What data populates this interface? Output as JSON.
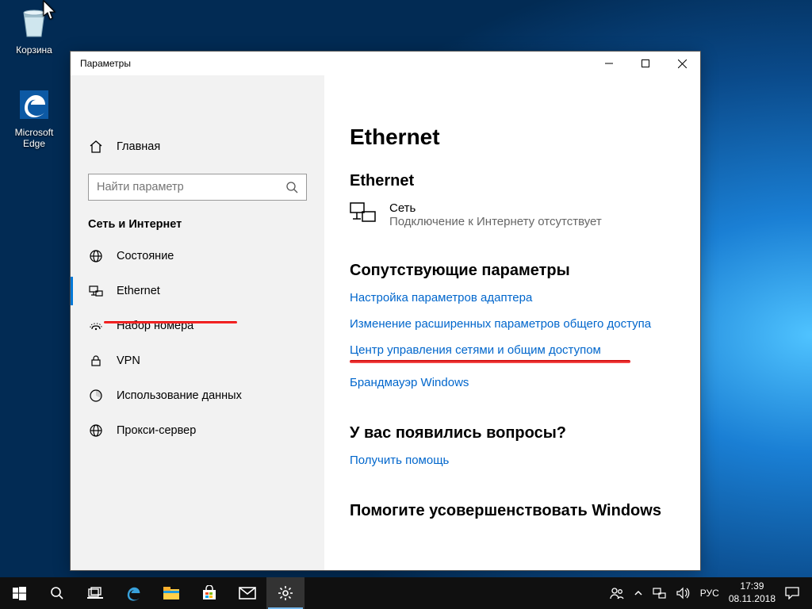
{
  "desktop": {
    "icons": {
      "recycle": "Корзина",
      "edge": "Microsoft\nEdge"
    }
  },
  "window": {
    "title": "Параметры"
  },
  "sidebar": {
    "home": "Главная",
    "search_placeholder": "Найти параметр",
    "section": "Сеть и Интернет",
    "items": [
      {
        "label": "Состояние"
      },
      {
        "label": "Ethernet"
      },
      {
        "label": "Набор номера"
      },
      {
        "label": "VPN"
      },
      {
        "label": "Использование данных"
      },
      {
        "label": "Прокси-сервер"
      }
    ]
  },
  "main": {
    "title": "Ethernet",
    "sub": "Ethernet",
    "network": {
      "name": "Сеть",
      "status": "Подключение к Интернету отсутствует"
    },
    "related": {
      "title": "Сопутствующие параметры",
      "links": [
        "Настройка параметров адаптера",
        "Изменение расширенных параметров общего доступа",
        "Центр управления сетями и общим доступом",
        "Брандмауэр Windows"
      ]
    },
    "questions": {
      "title": "У вас появились вопросы?",
      "link": "Получить помощь"
    },
    "help": {
      "title": "Помогите усовершенствовать Windows"
    }
  },
  "taskbar": {
    "lang": "РУС",
    "time": "17:39",
    "date": "08.11.2018"
  }
}
